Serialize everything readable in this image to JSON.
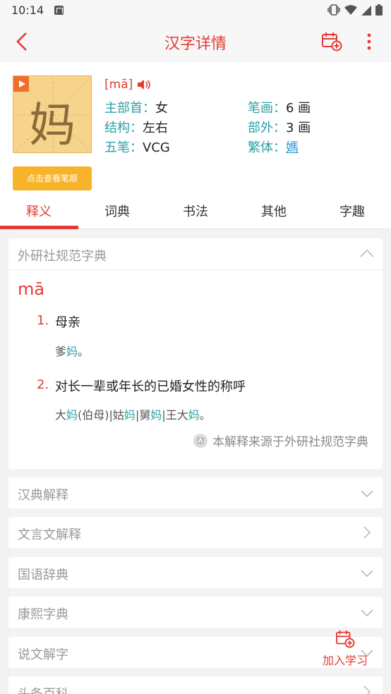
{
  "status_bar": {
    "time": "10:14"
  },
  "header": {
    "title": "汉字详情"
  },
  "character": {
    "glyph": "妈",
    "stroke_order_button": "点击查看笔顺",
    "pinyin": "[mā]",
    "fields": {
      "radical_label": "主部首：",
      "radical_value": "女",
      "strokes_label": "笔画：",
      "strokes_value": "6 画",
      "structure_label": "结构：",
      "structure_value": "左右",
      "outer_label": "部外：",
      "outer_value": "3 画",
      "wubi_label": "五笔：",
      "wubi_value": "VCG",
      "traditional_label": "繁体：",
      "traditional_value": "媽"
    }
  },
  "tabs": [
    {
      "label": "释义",
      "active": true
    },
    {
      "label": "词典",
      "active": false
    },
    {
      "label": "书法",
      "active": false
    },
    {
      "label": "其他",
      "active": false
    },
    {
      "label": "字趣",
      "active": false
    }
  ],
  "definition_card": {
    "title": "外研社规范字典",
    "pinyin": "mā",
    "definitions": [
      {
        "num": "1.",
        "text": "母亲",
        "example_parts": [
          "爹",
          "妈",
          "。"
        ]
      },
      {
        "num": "2.",
        "text": "对长一辈或年长的已婚女性的称呼",
        "example_parts": [
          "大",
          "妈",
          "(伯母)|姑",
          "妈",
          "|舅",
          "妈",
          "|王大",
          "妈",
          "。"
        ]
      }
    ],
    "source": "本解释来源于外研社规范字典"
  },
  "sections": [
    {
      "label": "汉典解释",
      "chevron": "down"
    },
    {
      "label": "文言文解释",
      "chevron": "right"
    },
    {
      "label": "国语辞典",
      "chevron": "down"
    },
    {
      "label": "康熙字典",
      "chevron": "down"
    },
    {
      "label": "说文解字",
      "chevron": "down"
    },
    {
      "label": "头条百科",
      "chevron": "right"
    }
  ],
  "float_button": {
    "label": "加入学习"
  },
  "colors": {
    "accent": "#e33b33",
    "teal": "#2aa1a8",
    "char_bg": "#f6d48b",
    "button": "#f7b42b"
  }
}
